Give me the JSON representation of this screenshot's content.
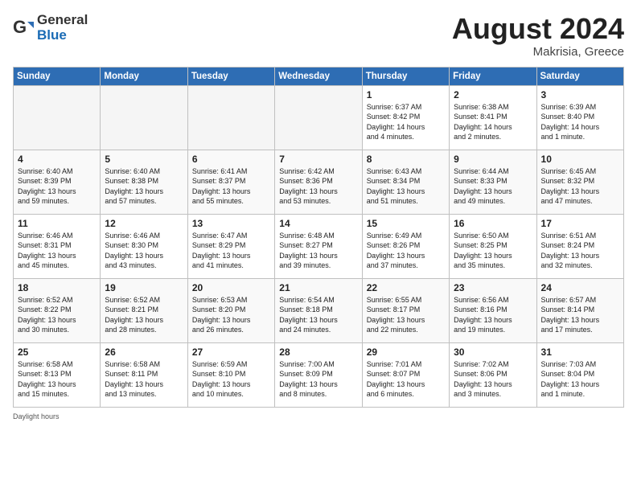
{
  "header": {
    "logo_general": "General",
    "logo_blue": "Blue",
    "month_year": "August 2024",
    "location": "Makrisia, Greece"
  },
  "days_of_week": [
    "Sunday",
    "Monday",
    "Tuesday",
    "Wednesday",
    "Thursday",
    "Friday",
    "Saturday"
  ],
  "footer": "Daylight hours",
  "weeks": [
    [
      {
        "num": "",
        "detail": ""
      },
      {
        "num": "",
        "detail": ""
      },
      {
        "num": "",
        "detail": ""
      },
      {
        "num": "",
        "detail": ""
      },
      {
        "num": "1",
        "detail": "Sunrise: 6:37 AM\nSunset: 8:42 PM\nDaylight: 14 hours\nand 4 minutes."
      },
      {
        "num": "2",
        "detail": "Sunrise: 6:38 AM\nSunset: 8:41 PM\nDaylight: 14 hours\nand 2 minutes."
      },
      {
        "num": "3",
        "detail": "Sunrise: 6:39 AM\nSunset: 8:40 PM\nDaylight: 14 hours\nand 1 minute."
      }
    ],
    [
      {
        "num": "4",
        "detail": "Sunrise: 6:40 AM\nSunset: 8:39 PM\nDaylight: 13 hours\nand 59 minutes."
      },
      {
        "num": "5",
        "detail": "Sunrise: 6:40 AM\nSunset: 8:38 PM\nDaylight: 13 hours\nand 57 minutes."
      },
      {
        "num": "6",
        "detail": "Sunrise: 6:41 AM\nSunset: 8:37 PM\nDaylight: 13 hours\nand 55 minutes."
      },
      {
        "num": "7",
        "detail": "Sunrise: 6:42 AM\nSunset: 8:36 PM\nDaylight: 13 hours\nand 53 minutes."
      },
      {
        "num": "8",
        "detail": "Sunrise: 6:43 AM\nSunset: 8:34 PM\nDaylight: 13 hours\nand 51 minutes."
      },
      {
        "num": "9",
        "detail": "Sunrise: 6:44 AM\nSunset: 8:33 PM\nDaylight: 13 hours\nand 49 minutes."
      },
      {
        "num": "10",
        "detail": "Sunrise: 6:45 AM\nSunset: 8:32 PM\nDaylight: 13 hours\nand 47 minutes."
      }
    ],
    [
      {
        "num": "11",
        "detail": "Sunrise: 6:46 AM\nSunset: 8:31 PM\nDaylight: 13 hours\nand 45 minutes."
      },
      {
        "num": "12",
        "detail": "Sunrise: 6:46 AM\nSunset: 8:30 PM\nDaylight: 13 hours\nand 43 minutes."
      },
      {
        "num": "13",
        "detail": "Sunrise: 6:47 AM\nSunset: 8:29 PM\nDaylight: 13 hours\nand 41 minutes."
      },
      {
        "num": "14",
        "detail": "Sunrise: 6:48 AM\nSunset: 8:27 PM\nDaylight: 13 hours\nand 39 minutes."
      },
      {
        "num": "15",
        "detail": "Sunrise: 6:49 AM\nSunset: 8:26 PM\nDaylight: 13 hours\nand 37 minutes."
      },
      {
        "num": "16",
        "detail": "Sunrise: 6:50 AM\nSunset: 8:25 PM\nDaylight: 13 hours\nand 35 minutes."
      },
      {
        "num": "17",
        "detail": "Sunrise: 6:51 AM\nSunset: 8:24 PM\nDaylight: 13 hours\nand 32 minutes."
      }
    ],
    [
      {
        "num": "18",
        "detail": "Sunrise: 6:52 AM\nSunset: 8:22 PM\nDaylight: 13 hours\nand 30 minutes."
      },
      {
        "num": "19",
        "detail": "Sunrise: 6:52 AM\nSunset: 8:21 PM\nDaylight: 13 hours\nand 28 minutes."
      },
      {
        "num": "20",
        "detail": "Sunrise: 6:53 AM\nSunset: 8:20 PM\nDaylight: 13 hours\nand 26 minutes."
      },
      {
        "num": "21",
        "detail": "Sunrise: 6:54 AM\nSunset: 8:18 PM\nDaylight: 13 hours\nand 24 minutes."
      },
      {
        "num": "22",
        "detail": "Sunrise: 6:55 AM\nSunset: 8:17 PM\nDaylight: 13 hours\nand 22 minutes."
      },
      {
        "num": "23",
        "detail": "Sunrise: 6:56 AM\nSunset: 8:16 PM\nDaylight: 13 hours\nand 19 minutes."
      },
      {
        "num": "24",
        "detail": "Sunrise: 6:57 AM\nSunset: 8:14 PM\nDaylight: 13 hours\nand 17 minutes."
      }
    ],
    [
      {
        "num": "25",
        "detail": "Sunrise: 6:58 AM\nSunset: 8:13 PM\nDaylight: 13 hours\nand 15 minutes."
      },
      {
        "num": "26",
        "detail": "Sunrise: 6:58 AM\nSunset: 8:11 PM\nDaylight: 13 hours\nand 13 minutes."
      },
      {
        "num": "27",
        "detail": "Sunrise: 6:59 AM\nSunset: 8:10 PM\nDaylight: 13 hours\nand 10 minutes."
      },
      {
        "num": "28",
        "detail": "Sunrise: 7:00 AM\nSunset: 8:09 PM\nDaylight: 13 hours\nand 8 minutes."
      },
      {
        "num": "29",
        "detail": "Sunrise: 7:01 AM\nSunset: 8:07 PM\nDaylight: 13 hours\nand 6 minutes."
      },
      {
        "num": "30",
        "detail": "Sunrise: 7:02 AM\nSunset: 8:06 PM\nDaylight: 13 hours\nand 3 minutes."
      },
      {
        "num": "31",
        "detail": "Sunrise: 7:03 AM\nSunset: 8:04 PM\nDaylight: 13 hours\nand 1 minute."
      }
    ]
  ]
}
